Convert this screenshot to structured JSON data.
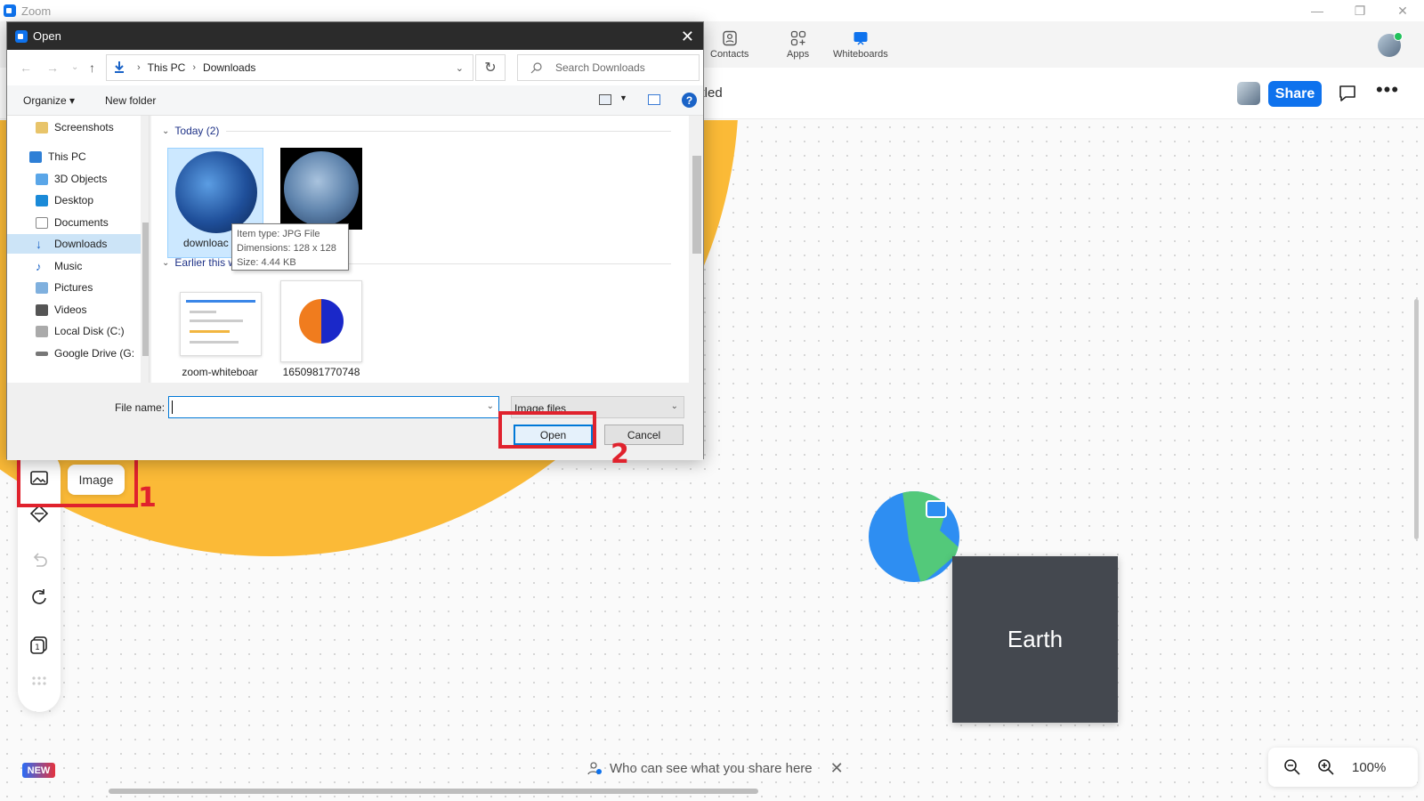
{
  "zoom": {
    "title": "Zoom",
    "nav": [
      {
        "label": "Contacts",
        "icon": "contacts-icon"
      },
      {
        "label": "Apps",
        "icon": "apps-icon"
      },
      {
        "label": "Whiteboards",
        "icon": "whiteboards-icon"
      }
    ]
  },
  "whiteboard": {
    "title_partial": "titled",
    "share_label": "Share",
    "more_label": "•••",
    "card_label": "Earth",
    "image_tool_label": "Image",
    "new_badge": "NEW",
    "share_notice": "Who can see what you share here",
    "zoom_percent": "100%"
  },
  "annotations": {
    "step1": "1",
    "step2": "2",
    "color": "#e0222d"
  },
  "dialog": {
    "title": "Open",
    "breadcrumb": [
      "This PC",
      "Downloads"
    ],
    "search_placeholder": "Search Downloads",
    "organize_label": "Organize ▾",
    "new_folder_label": "New folder",
    "nav_items": [
      {
        "label": "Screenshots"
      },
      {
        "label": "This PC"
      },
      {
        "label": "3D Objects"
      },
      {
        "label": "Desktop"
      },
      {
        "label": "Documents"
      },
      {
        "label": "Downloads",
        "selected": true
      },
      {
        "label": "Music"
      },
      {
        "label": "Pictures"
      },
      {
        "label": "Videos"
      },
      {
        "label": "Local Disk (C:)"
      },
      {
        "label": "Google Drive (G:"
      }
    ],
    "groups": [
      {
        "label": "Today (2)"
      },
      {
        "label": "Earlier this week (2)"
      }
    ],
    "files": [
      {
        "name": "downloac"
      },
      {
        "name": ""
      },
      {
        "name": "zoom-whiteboar"
      },
      {
        "name": "1650981770748"
      }
    ],
    "tooltip": {
      "line1": "Item type: JPG File",
      "line2": "Dimensions: 128 x 128",
      "line3": "Size: 4.44 KB"
    },
    "file_name_label": "File name:",
    "file_name_value": "",
    "file_type": "Image files",
    "open_label": "Open",
    "cancel_label": "Cancel"
  }
}
